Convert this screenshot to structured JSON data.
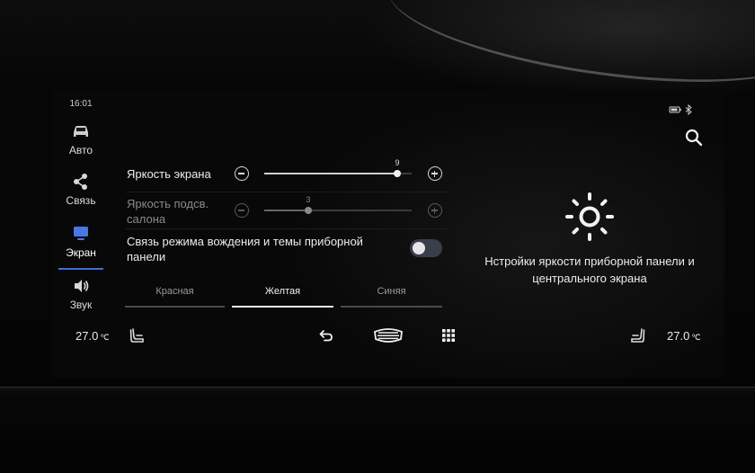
{
  "status": {
    "time": "16:01",
    "battery_icon": "battery-icon",
    "bluetooth_icon": "bluetooth-icon"
  },
  "sidebar": {
    "items": [
      {
        "label": "Авто",
        "icon": "car-icon"
      },
      {
        "label": "Связь",
        "icon": "share-icon"
      },
      {
        "label": "Экран",
        "icon": "display-icon",
        "active": true
      },
      {
        "label": "Звук",
        "icon": "speaker-icon"
      }
    ]
  },
  "settings": {
    "screen_brightness": {
      "label": "Яркость экрана",
      "value": "9",
      "level": 9,
      "max": 10
    },
    "cabin_backlight": {
      "label_line1": "Яркость подсв.",
      "label_line2": "салона",
      "value": "3",
      "level": 3,
      "max": 10
    },
    "drive_mode_link": {
      "label_line1": "Связь режима вождения и темы приборной",
      "label_line2": "панели",
      "enabled": false
    },
    "themes": [
      {
        "label": "Красная"
      },
      {
        "label": "Желтая",
        "active": true
      },
      {
        "label": "Синяя"
      }
    ]
  },
  "info": {
    "icon": "brightness-sun-icon",
    "line1": "Нстройки яркости приборной панели и",
    "line2": "центрального экрана"
  },
  "climate": {
    "left_temp": "27.0",
    "right_temp": "27.0",
    "unit": "℃"
  },
  "colors": {
    "accent": "#3d6fd8",
    "background": "#050505",
    "text": "#ececec"
  }
}
